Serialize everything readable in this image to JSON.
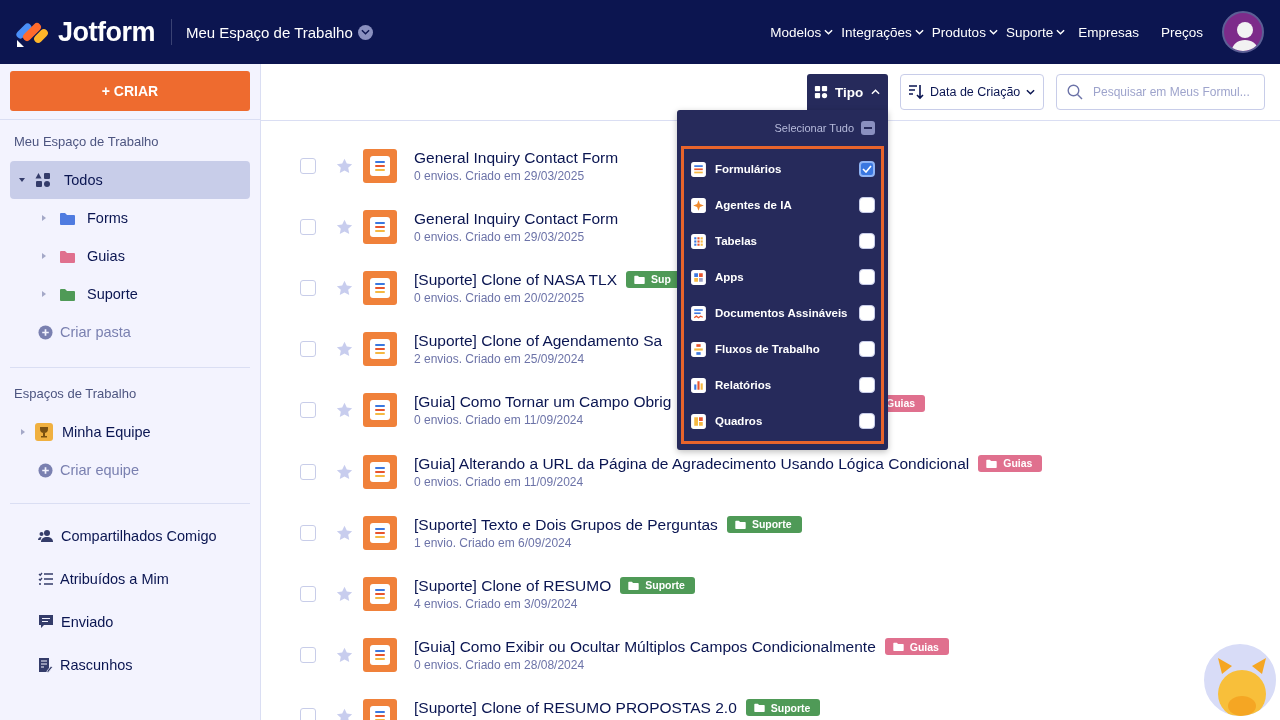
{
  "header": {
    "brand": "Jotform",
    "workspace": "Meu Espaço de Trabalho",
    "nav": [
      {
        "label": "Modelos",
        "has_menu": true
      },
      {
        "label": "Integrações",
        "has_menu": true
      },
      {
        "label": "Produtos",
        "has_menu": true
      },
      {
        "label": "Suporte",
        "has_menu": true
      },
      {
        "label": "Empresas",
        "has_menu": false
      },
      {
        "label": "Preços",
        "has_menu": false
      }
    ]
  },
  "sidebar": {
    "create_button": "+ CRIAR",
    "my_workspace": {
      "title": "Meu Espaço de Trabalho",
      "root": {
        "label": "Todos",
        "selected": true,
        "expanded": true,
        "children": [
          {
            "label": "Forms",
            "color": "#4f7be0",
            "selected": false
          },
          {
            "label": "Guias",
            "color": "#e0708e",
            "selected": false
          },
          {
            "label": "Suporte",
            "color": "#4f9a57",
            "selected": false
          }
        ]
      },
      "add": "Criar pasta"
    },
    "workspaces": {
      "title": "Espaços de Trabalho",
      "items": [
        {
          "label": "Minha Equipe",
          "selected": false
        }
      ],
      "add": "Criar equipe"
    },
    "links": [
      {
        "kind": "shared",
        "label": "Compartilhados Comigo"
      },
      {
        "kind": "assigned",
        "label": "Atribuídos a Mim"
      },
      {
        "kind": "sent",
        "label": "Enviado"
      },
      {
        "kind": "drafts",
        "label": "Rascunhos"
      }
    ]
  },
  "toolbar": {
    "type_filter": {
      "label": "Tipo",
      "expanded": true
    },
    "sort": {
      "label": "Data de Criação"
    },
    "search": {
      "placeholder": "Pesquisar em Meus Formul..."
    }
  },
  "type_menu": {
    "select_all": {
      "label": "Selecionar Tudo",
      "mixed": true
    },
    "items": [
      {
        "kind": "form",
        "label": "Formulários",
        "checked": true
      },
      {
        "kind": "agent",
        "label": "Agentes de IA",
        "checked": false
      },
      {
        "kind": "table",
        "label": "Tabelas",
        "checked": false
      },
      {
        "kind": "app",
        "label": "Apps",
        "checked": false
      },
      {
        "kind": "sign",
        "label": "Documentos Assináveis",
        "checked": false
      },
      {
        "kind": "workflow",
        "label": "Fluxos de Trabalho",
        "checked": false
      },
      {
        "kind": "report",
        "label": "Relatórios",
        "checked": false
      },
      {
        "kind": "board",
        "label": "Quadros",
        "checked": false
      }
    ]
  },
  "forms": [
    {
      "title": "General Inquiry Contact Form",
      "meta": "0 envios. Criado em 29/03/2025",
      "checked": false,
      "starred": false
    },
    {
      "title": "General Inquiry Contact Form",
      "meta": "0 envios. Criado em 29/03/2025",
      "checked": false,
      "starred": false
    },
    {
      "title": "[Suporte] Clone of NASA TLX",
      "meta": "0 envios. Criado em 20/02/2025",
      "checked": false,
      "starred": false,
      "tag": {
        "label": "Sup",
        "color": "#4f9a57"
      }
    },
    {
      "title": "[Suporte] Clone of Agendamento Sa",
      "meta": "2 envios. Criado em 25/09/2024",
      "checked": false,
      "starred": false
    },
    {
      "title": "[Guia] Como Tornar um Campo Obrig",
      "meta": "0 envios. Criado em 11/09/2024",
      "checked": false,
      "starred": false,
      "under_menu": true,
      "tag": {
        "label": "Guias",
        "color": "#e0708e"
      }
    },
    {
      "title": "[Guia] Alterando a URL da Página de Agradecimento Usando Lógica Condicional",
      "meta": "0 envios. Criado em 11/09/2024",
      "checked": false,
      "starred": false,
      "tag": {
        "label": "Guias",
        "color": "#e0708e"
      }
    },
    {
      "title": "[Suporte] Texto e Dois Grupos de Perguntas",
      "meta": "1 envio. Criado em 6/09/2024",
      "checked": false,
      "starred": false,
      "tag": {
        "label": "Suporte",
        "color": "#4f9a57"
      }
    },
    {
      "title": "[Suporte] Clone of RESUMO",
      "meta": "4 envios. Criado em 3/09/2024",
      "checked": false,
      "starred": false,
      "tag": {
        "label": "Suporte",
        "color": "#4f9a57"
      }
    },
    {
      "title": "[Guia] Como Exibir ou Ocultar Múltiplos Campos Condicionalmente",
      "meta": "0 envios. Criado em 28/08/2024",
      "checked": false,
      "starred": false,
      "tag": {
        "label": "Guias",
        "color": "#e0708e"
      }
    },
    {
      "title": "[Suporte] Clone of RESUMO PROPOSTAS 2.0",
      "checked": false,
      "starred": false,
      "tag": {
        "label": "Suporte",
        "color": "#4f9a57"
      }
    }
  ]
}
